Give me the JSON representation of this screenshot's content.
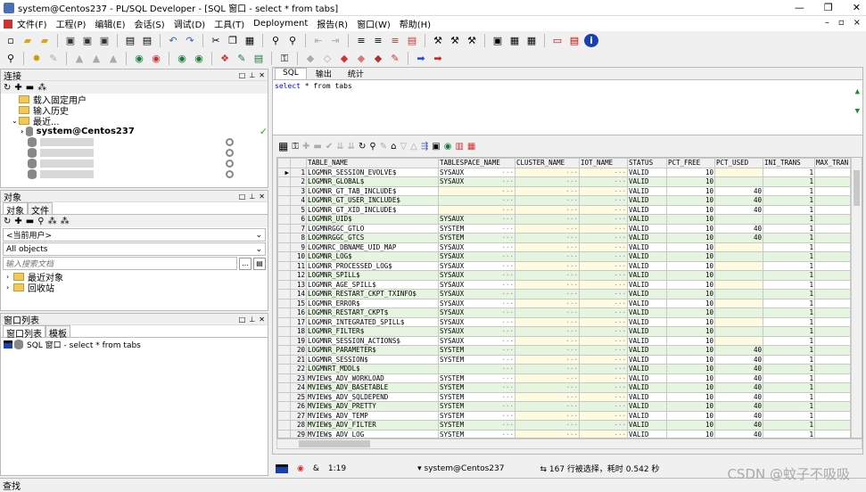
{
  "window": {
    "title": "system@Centos237 - PL/SQL Developer - [SQL 窗口 - select * from tabs]",
    "controls": [
      "—",
      "❐",
      "✕"
    ]
  },
  "menu": [
    "文件(F)",
    "工程(P)",
    "编辑(E)",
    "会话(S)",
    "调试(D)",
    "工具(T)",
    "Deployment",
    "报告(R)",
    "窗口(W)",
    "帮助(H)"
  ],
  "menu_right": [
    "–",
    "▫",
    "×"
  ],
  "connection_panel": {
    "title": "连接",
    "items": [
      {
        "label": "载入固定用户",
        "type": "folder"
      },
      {
        "label": "输入历史",
        "type": "folder"
      },
      {
        "label": "最近...",
        "type": "folder"
      },
      {
        "label": "system@Centos237",
        "type": "db"
      }
    ]
  },
  "objects_panel": {
    "title": "对象",
    "tabs": [
      "对象",
      "文件"
    ],
    "user_combo": "<当前用户>",
    "type_combo": "All objects",
    "search_placeholder": "输入搜索文档",
    "items": [
      "最近对象",
      "回收站"
    ]
  },
  "window_list_panel": {
    "title": "窗口列表",
    "tabs": [
      "窗口列表",
      "模板"
    ],
    "items": [
      "SQL 窗口 - select * from tabs"
    ]
  },
  "editor": {
    "tabs": [
      "SQL",
      "输出",
      "统计"
    ],
    "sql_keyword": "select",
    "sql_rest": " * from tabs"
  },
  "grid": {
    "columns": [
      "TABLE_NAME",
      "TABLESPACE_NAME",
      "CLUSTER_NAME",
      "IOT_NAME",
      "STATUS",
      "PCT_FREE",
      "PCT_USED",
      "INI_TRANS",
      "MAX_TRAN"
    ],
    "rows": [
      [
        "LOGMNR_SESSION_EVOLVE$",
        "SYSAUX",
        "",
        "",
        "VALID",
        "10",
        "",
        "1"
      ],
      [
        "LOGMNR_GLOBAL$",
        "SYSAUX",
        "",
        "",
        "VALID",
        "10",
        "",
        "1"
      ],
      [
        "LOGMNR_GT_TAB_INCLUDE$",
        "",
        "",
        "",
        "VALID",
        "10",
        "40",
        "1"
      ],
      [
        "LOGMNR_GT_USER_INCLUDE$",
        "",
        "",
        "",
        "VALID",
        "10",
        "40",
        "1"
      ],
      [
        "LOGMNR_GT_XID_INCLUDE$",
        "",
        "",
        "",
        "VALID",
        "10",
        "40",
        "1"
      ],
      [
        "LOGMNR_UID$",
        "SYSAUX",
        "",
        "",
        "VALID",
        "10",
        "",
        "1"
      ],
      [
        "LOGMNRGGC_GTLO",
        "SYSTEM",
        "",
        "",
        "VALID",
        "10",
        "40",
        "1"
      ],
      [
        "LOGMNRGGC_GTCS",
        "SYSTEM",
        "",
        "",
        "VALID",
        "10",
        "40",
        "1"
      ],
      [
        "LOGMNRC_DBNAME_UID_MAP",
        "SYSAUX",
        "",
        "",
        "VALID",
        "10",
        "",
        "1"
      ],
      [
        "LOGMNR_LOG$",
        "SYSAUX",
        "",
        "",
        "VALID",
        "10",
        "",
        "1"
      ],
      [
        "LOGMNR_PROCESSED_LOG$",
        "SYSAUX",
        "",
        "",
        "VALID",
        "10",
        "",
        "1"
      ],
      [
        "LOGMNR_SPILL$",
        "SYSAUX",
        "",
        "",
        "VALID",
        "10",
        "",
        "1"
      ],
      [
        "LOGMNR_AGE_SPILL$",
        "SYSAUX",
        "",
        "",
        "VALID",
        "10",
        "",
        "1"
      ],
      [
        "LOGMNR_RESTART_CKPT_TXINFO$",
        "SYSAUX",
        "",
        "",
        "VALID",
        "10",
        "",
        "1"
      ],
      [
        "LOGMNR_ERROR$",
        "SYSAUX",
        "",
        "",
        "VALID",
        "10",
        "",
        "1"
      ],
      [
        "LOGMNR_RESTART_CKPT$",
        "SYSAUX",
        "",
        "",
        "VALID",
        "10",
        "",
        "1"
      ],
      [
        "LOGMNR_INTEGRATED_SPILL$",
        "SYSAUX",
        "",
        "",
        "VALID",
        "10",
        "",
        "1"
      ],
      [
        "LOGMNR_FILTER$",
        "SYSAUX",
        "",
        "",
        "VALID",
        "10",
        "",
        "1"
      ],
      [
        "LOGMNR_SESSION_ACTIONS$",
        "SYSAUX",
        "",
        "",
        "VALID",
        "10",
        "",
        "1"
      ],
      [
        "LOGMNR_PARAMETER$",
        "SYSTEM",
        "",
        "",
        "VALID",
        "10",
        "40",
        "1"
      ],
      [
        "LOGMNR_SESSION$",
        "SYSTEM",
        "",
        "",
        "VALID",
        "10",
        "40",
        "1"
      ],
      [
        "LOGMNRT_MDDL$",
        "",
        "",
        "",
        "VALID",
        "10",
        "40",
        "1"
      ],
      [
        "MVIEW$_ADV_WORKLOAD",
        "SYSTEM",
        "",
        "",
        "VALID",
        "10",
        "40",
        "1"
      ],
      [
        "MVIEW$_ADV_BASETABLE",
        "SYSTEM",
        "",
        "",
        "VALID",
        "10",
        "40",
        "1"
      ],
      [
        "MVIEW$_ADV_SQLDEPEND",
        "SYSTEM",
        "",
        "",
        "VALID",
        "10",
        "40",
        "1"
      ],
      [
        "MVIEW$_ADV_PRETTY",
        "SYSTEM",
        "",
        "",
        "VALID",
        "10",
        "40",
        "1"
      ],
      [
        "MVIEW$_ADV_TEMP",
        "SYSTEM",
        "",
        "",
        "VALID",
        "10",
        "40",
        "1"
      ],
      [
        "MVIEW$_ADV_FILTER",
        "SYSTEM",
        "",
        "",
        "VALID",
        "10",
        "40",
        "1"
      ],
      [
        "MVIEW$_ADV_LOG",
        "SYSTEM",
        "",
        "",
        "VALID",
        "10",
        "40",
        "1"
      ]
    ]
  },
  "status": {
    "position": "1:19",
    "connection": "system@Centos237",
    "message": "167 行被选择，耗时 0.542 秒"
  },
  "find_bar": "查找",
  "watermark": "CSDN @蚊子不吸吸"
}
